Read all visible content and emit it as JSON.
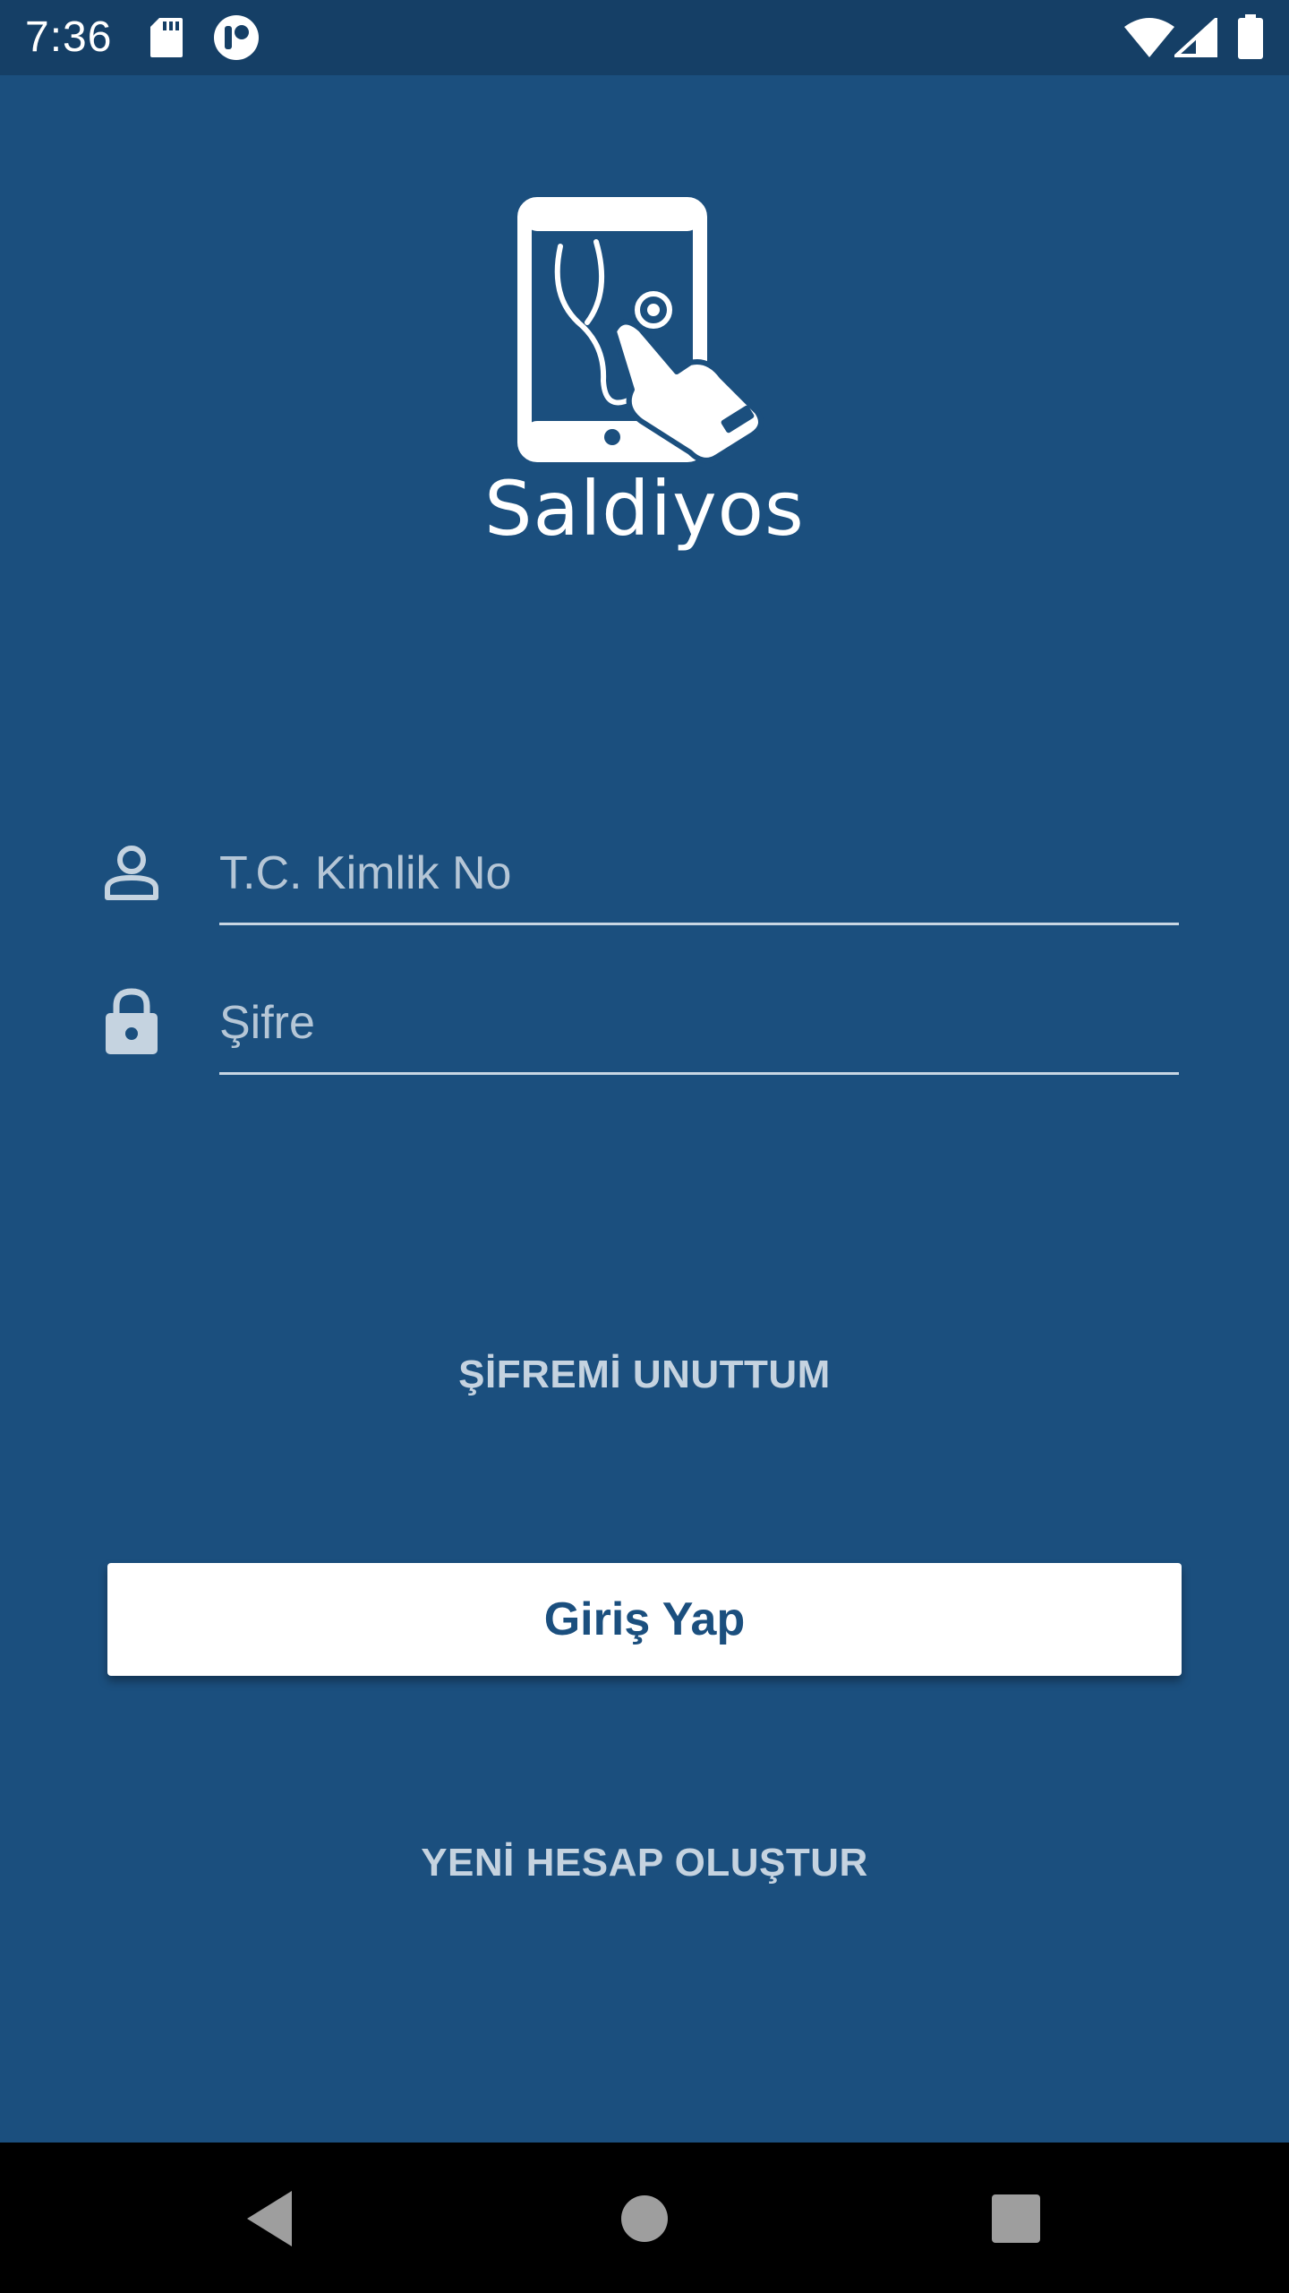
{
  "status_bar": {
    "time": "7:36",
    "icons": [
      "sd-card-icon",
      "app-notification-icon",
      "wifi-icon",
      "signal-icon",
      "battery-icon"
    ]
  },
  "app": {
    "brand_name": "Saldiyos",
    "logo_icon": "tablet-stethoscope-hand-icon"
  },
  "form": {
    "tc_placeholder": "T.C. Kimlik No",
    "tc_value": "",
    "password_placeholder": "Şifre",
    "password_value": "",
    "forgot_password": "ŞİFREMİ UNUTTUM",
    "login_button": "Giriş Yap",
    "create_account": "YENİ HESAP OLUŞTUR"
  },
  "nav_bar": {
    "icons": [
      "back-icon",
      "home-icon",
      "recents-icon"
    ]
  },
  "colors": {
    "background": "#1b4f7e",
    "status_bar": "#153f66",
    "button_bg": "#ffffff",
    "button_text": "#1b4f7e",
    "muted_text": "#c5d3e0"
  }
}
